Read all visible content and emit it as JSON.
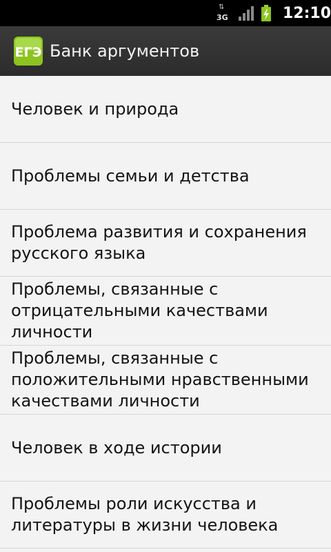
{
  "status_bar": {
    "network_type": "3G",
    "clock": "12:10"
  },
  "app": {
    "title": "Банк аргументов",
    "logo_text": "ЕГЭ"
  },
  "topics": [
    "Человек и природа",
    "Проблемы семьи и детства",
    "Проблема развития и сохранения русского языка",
    "Проблемы, связанные с отрицательными качествами личности",
    "Проблемы, связанные с положительными нравственными качествами личности",
    "Человек в ходе истории",
    "Проблемы роли искусства и литературы в жизни человека"
  ],
  "colors": {
    "status_bar_bg": "#000000",
    "title_bar_bg": "#2f2f2f",
    "list_bg": "#f3f3f3",
    "logo_green": "#8cc31f",
    "battery_green": "#8cc51f"
  },
  "icons": {
    "network": "3g-data-icon",
    "signal": "signal-strength-icon",
    "battery": "battery-charging-icon",
    "logo": "ege-logo-icon"
  }
}
